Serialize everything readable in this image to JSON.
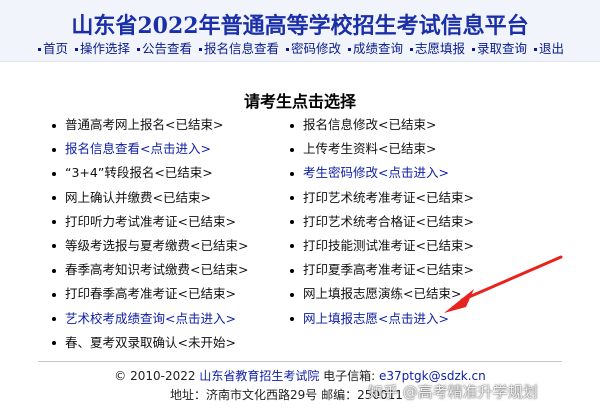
{
  "header": {
    "title": "山东省2022年普通高等学校招生考试信息平台",
    "nav": [
      "首页",
      "操作选择",
      "公告查看",
      "报名信息查看",
      "密码修改",
      "成绩查询",
      "志愿填报",
      "录取查询",
      "退出"
    ]
  },
  "prompt": "请考生点击选择",
  "left_items": [
    {
      "label": "普通高考网上报名<已结束>",
      "link": false
    },
    {
      "label": "报名信息查看<点击进入>",
      "link": true
    },
    {
      "label": "“3+4”转段报名<已结束>",
      "link": false
    },
    {
      "label": "网上确认并缴费<已结束>",
      "link": false
    },
    {
      "label": "打印听力考试准考证<已结束>",
      "link": false
    },
    {
      "label": "等级考选报与夏考缴费<已结束>",
      "link": false
    },
    {
      "label": "春季高考知识考试缴费<已结束>",
      "link": false
    },
    {
      "label": "打印春季高考准考证<已结束>",
      "link": false
    },
    {
      "label": "艺术校考成绩查询<点击进入>",
      "link": true
    },
    {
      "label": "春、夏考双录取确认<未开始>",
      "link": false
    }
  ],
  "right_items": [
    {
      "label": "报名信息修改<已结束>",
      "link": false
    },
    {
      "label": "上传考生资料<已结束>",
      "link": false
    },
    {
      "label": "考生密码修改<点击进入>",
      "link": true
    },
    {
      "label": "打印艺术统考准考证<已结束>",
      "link": false
    },
    {
      "label": "打印艺术统考合格证<已结束>",
      "link": false
    },
    {
      "label": "打印技能测试准考证<已结束>",
      "link": false
    },
    {
      "label": "打印夏季高考准考证<已结束>",
      "link": false
    },
    {
      "label": "网上填报志愿演练<已结束>",
      "link": false
    },
    {
      "label": "网上填报志愿<点击进入>",
      "link": true
    }
  ],
  "footer": {
    "copyright_prefix": "© 2010-2022 ",
    "org": "山东省教育招生考试院",
    "email_label": " 电子信箱: ",
    "email": "e37ptgk@sdzk.cn",
    "address": "地址：济南市文化西路29号 邮编：250011"
  },
  "watermark": "知乎 @高考精准升学规划",
  "colors": {
    "title": "#1b2fa8",
    "link": "#1020a8",
    "arrow": "#e8231d"
  }
}
